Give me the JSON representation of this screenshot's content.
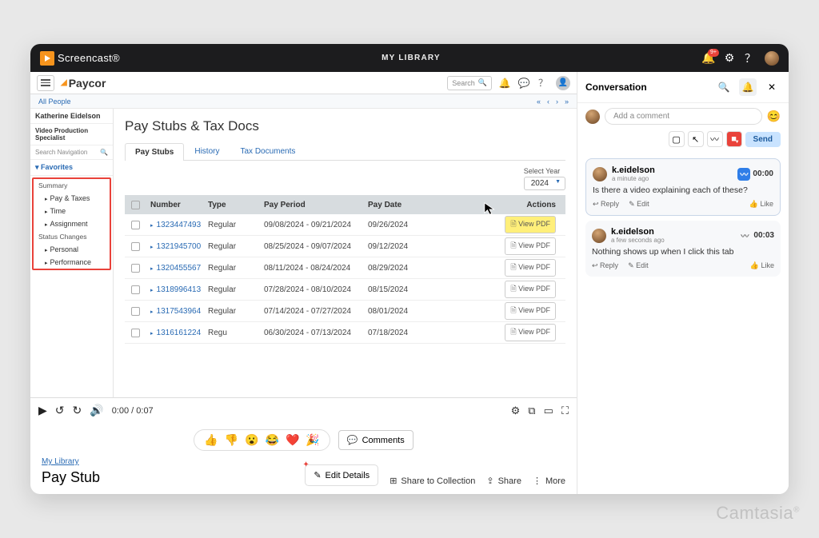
{
  "topbar": {
    "brand": "Screencast®",
    "center_title": "MY LIBRARY",
    "notif_badge": "9+"
  },
  "paycor": {
    "breadcrumb": "All People",
    "search_placeholder": "Search",
    "person_name": "Katherine Eidelson",
    "role": "Video Production Specialist",
    "search_nav": "Search Navigation",
    "fav_label": "Favorites",
    "grp_summary": "Summary",
    "items1": [
      "Pay & Taxes",
      "Time",
      "Assignment"
    ],
    "grp_status": "Status Changes",
    "items2": [
      "Personal",
      "Performance"
    ]
  },
  "page": {
    "title": "Pay Stubs & Tax Docs",
    "tabs": [
      "Pay Stubs",
      "History",
      "Tax Documents"
    ],
    "year_label": "Select Year",
    "year_value": "2024",
    "headers": {
      "number": "Number",
      "type": "Type",
      "period": "Pay Period",
      "date": "Pay Date",
      "actions": "Actions"
    },
    "view_pdf": "View PDF",
    "rows": [
      {
        "num": "1323447493",
        "type": "Regular",
        "period": "09/08/2024 - 09/21/2024",
        "date": "09/26/2024"
      },
      {
        "num": "1321945700",
        "type": "Regular",
        "period": "08/25/2024 - 09/07/2024",
        "date": "09/12/2024"
      },
      {
        "num": "1320455567",
        "type": "Regular",
        "period": "08/11/2024 - 08/24/2024",
        "date": "08/29/2024"
      },
      {
        "num": "1318996413",
        "type": "Regular",
        "period": "07/28/2024 - 08/10/2024",
        "date": "08/15/2024"
      },
      {
        "num": "1317543964",
        "type": "Regular",
        "period": "07/14/2024 - 07/27/2024",
        "date": "08/01/2024"
      },
      {
        "num": "1316161224",
        "type": "Regu",
        "period": "06/30/2024 - 07/13/2024",
        "date": "07/18/2024"
      }
    ]
  },
  "player": {
    "time": "0:00 / 0:07"
  },
  "reactions": {
    "comments_btn": "Comments"
  },
  "footer": {
    "breadcrumb": "My Library",
    "title": "Pay Stub",
    "edit": "Edit Details",
    "share_collection": "Share to Collection",
    "share": "Share",
    "more": "More"
  },
  "conv": {
    "title": "Conversation",
    "add_placeholder": "Add a comment",
    "send": "Send",
    "reply": "Reply",
    "edit": "Edit",
    "like": "Like",
    "comments": [
      {
        "user": "k.eidelson",
        "time": "a minute ago",
        "ts": "00:00",
        "body": "Is there a video explaining each of these?",
        "blue": true
      },
      {
        "user": "k.eidelson",
        "time": "a few seconds ago",
        "ts": "00:03",
        "body": "Nothing shows up when I click this tab",
        "blue": false
      }
    ]
  },
  "watermark": "Camtasia"
}
